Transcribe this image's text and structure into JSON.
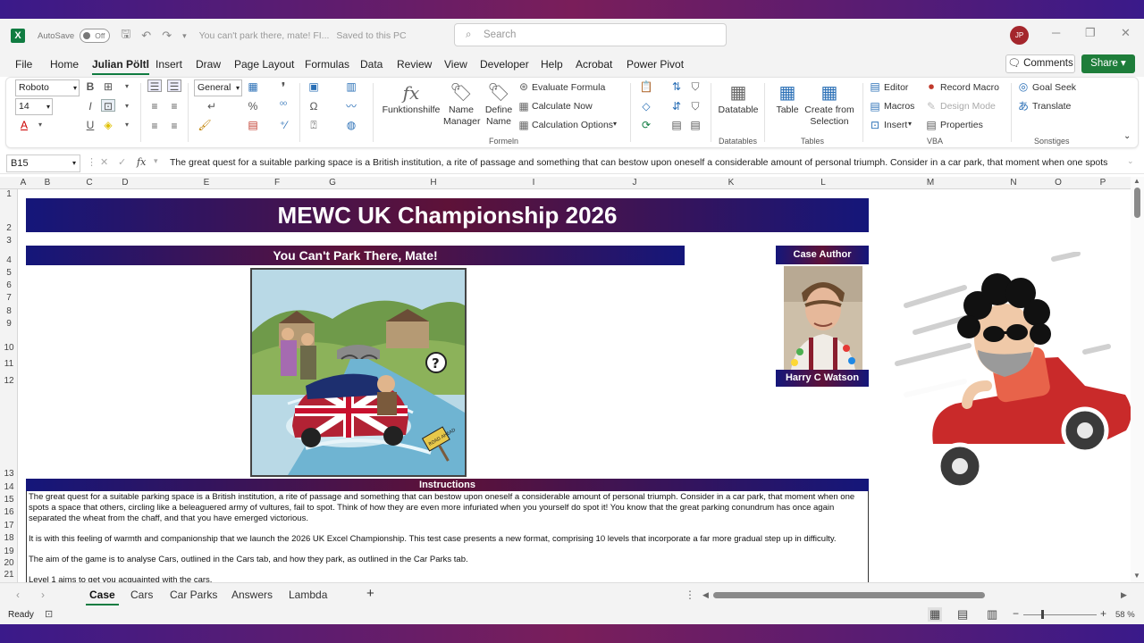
{
  "title_bar": {
    "autosave_label": "AutoSave",
    "autosave_state": "Off",
    "document_title": "You can't park there, mate! FI...",
    "save_status": "Saved to this PC",
    "search_placeholder": "Search",
    "user_initials": "JP"
  },
  "menu": {
    "tabs": [
      "File",
      "Home",
      "Julian Pöltl",
      "Insert",
      "Draw",
      "Page Layout",
      "Formulas",
      "Data",
      "Review",
      "View",
      "Developer",
      "Help",
      "Acrobat",
      "Power Pivot"
    ],
    "active_tab": "Julian Pöltl",
    "comments_label": "Comments",
    "share_label": "Share"
  },
  "ribbon": {
    "font_name": "Roboto",
    "font_size": "14",
    "number_format": "General",
    "funktionshilfe": "Funktionshilfe",
    "name_manager": "Name Manager",
    "define_name": "Define Name",
    "evaluate_formula": "Evaluate Formula",
    "calculate_now": "Calculate Now",
    "calculation_options": "Calculation Options",
    "formeln_group": "Formeln",
    "datatable": "Datatable",
    "datatables_group": "Datatables",
    "table": "Table",
    "create_from_selection": "Create from Selection",
    "tables_group": "Tables",
    "editor": "Editor",
    "macros": "Macros",
    "insert": "Insert",
    "record_macro": "Record Macro",
    "design_mode": "Design Mode",
    "properties": "Properties",
    "vba_group": "VBA",
    "goal_seek": "Goal Seek",
    "translate": "Translate",
    "sonstiges_group": "Sonstiges"
  },
  "formula_bar": {
    "cell_ref": "B15",
    "content": "The great quest for a suitable parking space is a British institution, a rite of passage and something that can bestow upon oneself a considerable amount of personal triumph. Consider in a car park, that moment when one spots"
  },
  "columns": [
    "A",
    "B",
    "C",
    "D",
    "E",
    "F",
    "G",
    "H",
    "I",
    "J",
    "K",
    "L",
    "M",
    "N",
    "O",
    "P"
  ],
  "rows": [
    "1",
    "2",
    "3",
    "4",
    "5",
    "6",
    "7",
    "8",
    "9",
    "10",
    "11",
    "12",
    "13",
    "14",
    "15",
    "16",
    "17",
    "18",
    "19",
    "20",
    "21"
  ],
  "sheet": {
    "main_title": "MEWC UK Championship 2026",
    "case_title": "You Can't Park There, Mate!",
    "author_header": "Case Author",
    "author_name": "Harry C Watson",
    "instructions_header": "Instructions",
    "instructions": [
      "The great quest for a suitable parking space is a British institution, a rite of passage and something that can bestow upon oneself a considerable amount of personal triumph. Consider in a car park, that moment when one spots a space that others, circling like a beleaguered army of vultures, fail to spot. Think of how they are even more infuriated when you yourself do spot it! You know that the great parking conundrum has once again separated the wheat from the chaff, and that you have emerged victorious.",
      "It is with this feeling of warmth and companionship that we launch the 2026 UK Excel Championship. This test case presents a new format, comprising 10 levels that incorporate a far more gradual step up in difficulty.",
      "The aim of the game is to analyse Cars, outlined in the Cars tab, and how they park, as outlined in the Car Parks tab.",
      "Level 1 aims to get you acquainted with the cars."
    ],
    "road_sign_text": "ROAD AHEAD"
  },
  "sheet_tabs": [
    "Case",
    "Cars",
    "Car Parks",
    "Answers",
    "Lambda"
  ],
  "active_sheet": "Case",
  "status": {
    "ready": "Ready",
    "zoom": "58 %"
  },
  "colors": {
    "excel_green": "#107c41",
    "banner_navy": "#14167a",
    "banner_maroon": "#5e1238"
  }
}
